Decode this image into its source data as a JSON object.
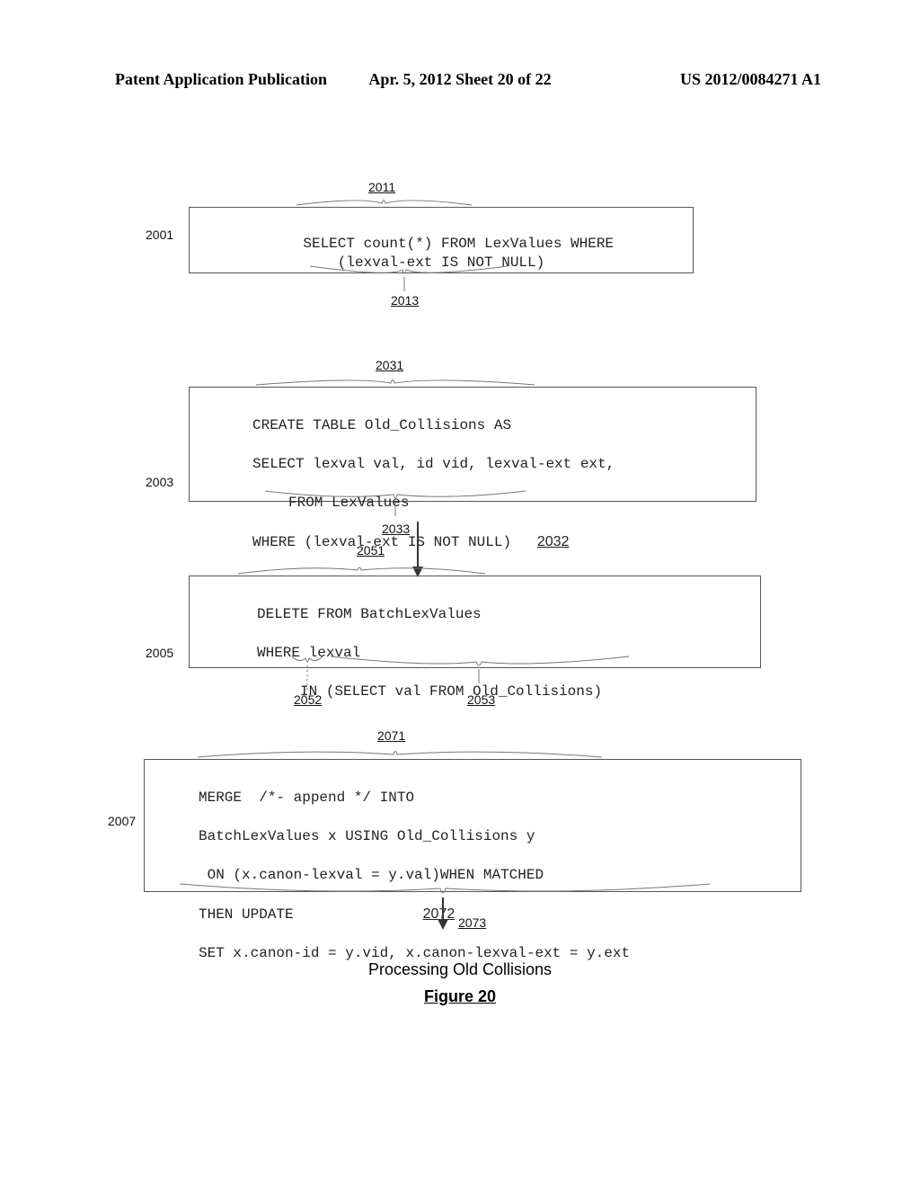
{
  "header": {
    "left": "Patent Application Publication",
    "center": "Apr. 5, 2012  Sheet 20 of 22",
    "right": "US 2012/0084271 A1"
  },
  "labels": {
    "l2001": "2001",
    "l2003": "2003",
    "l2005": "2005",
    "l2007": "2007"
  },
  "refs": {
    "r2011": "2011",
    "r2013": "2013",
    "r2031": "2031",
    "r2032": "2032",
    "r2033": "2033",
    "r2051": "2051",
    "r2052": "2052",
    "r2053": "2053",
    "r2071": "2071",
    "r2072": "2072",
    "r2073": "2073"
  },
  "box1": {
    "code": "SELECT count(*) FROM LexValues WHERE\n(lexval-ext IS NOT NULL)"
  },
  "box2": {
    "line1": "CREATE TABLE Old_Collisions AS",
    "line2": "SELECT lexval val, id vid, lexval-ext ext,",
    "line3": "FROM LexValues",
    "line4_a": "WHERE (lexval-ext IS NOT NULL)",
    "line4_ref": "2032"
  },
  "box3": {
    "line1": "DELETE FROM BatchLexValues",
    "line2": "WHERE lexval",
    "line3": "     IN (SELECT val FROM Old_Collisions)"
  },
  "box4": {
    "line1": "MERGE  /*- append */ INTO",
    "line2": "BatchLexValues x USING Old_Collisions y",
    "line3_a": " ON (x.canon-lexval = y.val)WHEN MATCHED",
    "line4": "THEN UPDATE",
    "line4_ref": "2072",
    "line5": "SET x.canon-id = y.vid, x.canon-lexval-ext = y.ext"
  },
  "caption": "Processing Old Collisions",
  "figure": "Figure 20"
}
